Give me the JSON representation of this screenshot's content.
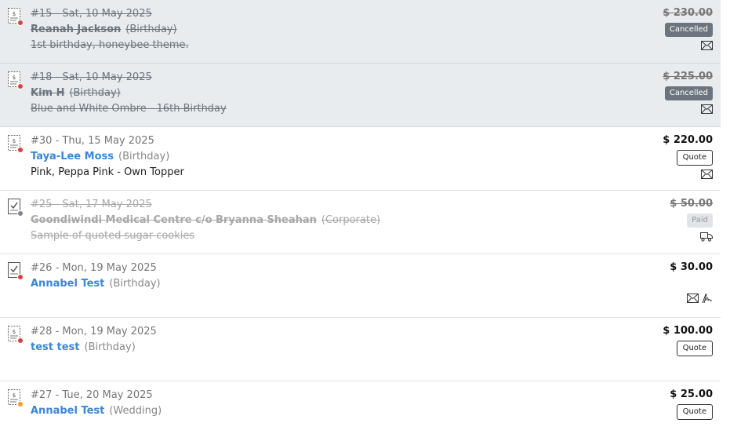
{
  "colors": {
    "accent": "#3a87d8",
    "dot_red": "#e0403a",
    "dot_gray": "#7d8590",
    "dot_orange": "#f0a020",
    "cancelled_badge": "#6c757d"
  },
  "orders": [
    {
      "heading": "#15 - Sat, 10 May 2025",
      "customer": "Reanah Jackson",
      "type": "(Birthday)",
      "description": "1st birthday, honeybee theme.",
      "price": "$ 230.00",
      "badge": "Cancelled",
      "status": "cancelled",
      "status_icon": "invoice-icon",
      "dot": "red",
      "icons": [
        "envelope-icon"
      ]
    },
    {
      "heading": "#18 - Sat, 10 May 2025",
      "customer": "Kim H",
      "type": "(Birthday)",
      "description": "Blue and White Ombre - 16th Birthday",
      "price": "$ 225.00",
      "badge": "Cancelled",
      "status": "cancelled",
      "status_icon": "invoice-icon",
      "dot": "red",
      "icons": [
        "envelope-icon"
      ]
    },
    {
      "heading": "#30 - Thu, 15 May 2025",
      "customer": "Taya-Lee Moss",
      "type": "(Birthday)",
      "description": "Pink, Peppa Pink - Own Topper",
      "price": "$ 220.00",
      "badge": "Quote",
      "status": "quote",
      "status_icon": "invoice-icon",
      "dot": "red",
      "icons": [
        "envelope-icon"
      ]
    },
    {
      "heading": "#25 - Sat, 17 May 2025",
      "customer": "Goondiwindi Medical Centre c/o Bryanna Sheahan",
      "type": "(Corporate)",
      "description": "Sample of quoted sugar cookies",
      "price": "$ 50.00",
      "badge": "Paid",
      "status": "paid",
      "status_icon": "checklist-icon",
      "dot": "gray",
      "icons": [
        "delivery-truck-icon"
      ]
    },
    {
      "heading": "#26 - Mon, 19 May 2025",
      "customer": "Annabel Test",
      "type": "(Birthday)",
      "description": "",
      "price": "$ 30.00",
      "badge": "",
      "status": "confirmed",
      "status_icon": "checklist-icon",
      "dot": "red",
      "icons": [
        "envelope-icon",
        "signature-icon"
      ]
    },
    {
      "heading": "#28 - Mon, 19 May 2025",
      "customer": "test test",
      "type": "(Birthday)",
      "description": "",
      "price": "$ 100.00",
      "badge": "Quote",
      "status": "quote",
      "status_icon": "invoice-icon",
      "dot": "red",
      "icons": []
    },
    {
      "heading": "#27 - Tue, 20 May 2025",
      "customer": "Annabel Test",
      "type": "(Wedding)",
      "description": "",
      "price": "$ 25.00",
      "badge": "Quote",
      "status": "quote",
      "status_icon": "invoice-icon",
      "dot": "orange",
      "icons": []
    }
  ]
}
